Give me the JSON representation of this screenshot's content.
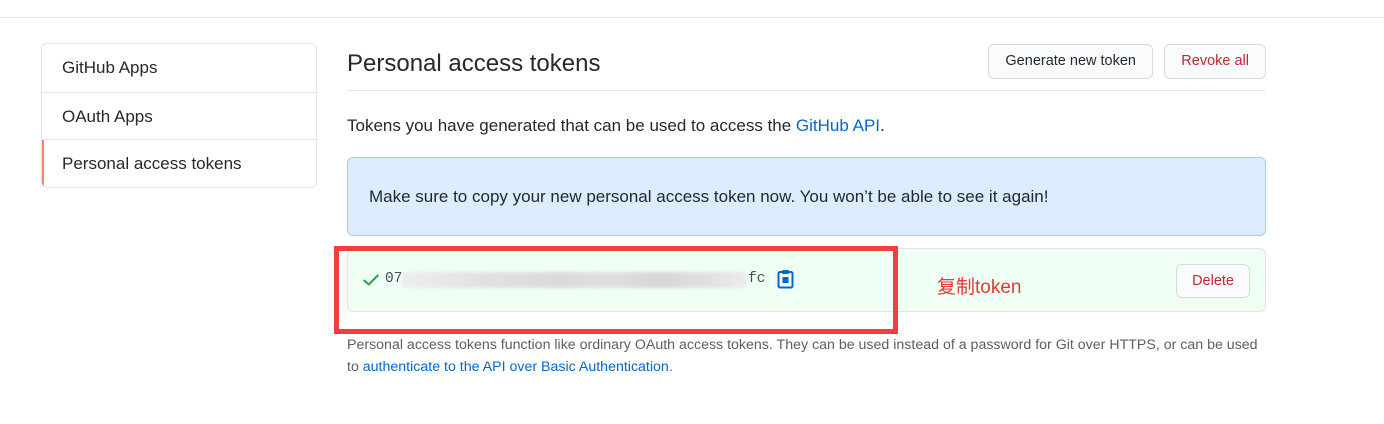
{
  "sidebar": {
    "items": [
      {
        "label": "GitHub Apps"
      },
      {
        "label": "OAuth Apps"
      },
      {
        "label": "Personal access tokens"
      }
    ]
  },
  "header": {
    "title": "Personal access tokens",
    "generate_label": "Generate new token",
    "revoke_label": "Revoke all"
  },
  "description": {
    "text": "Tokens you have generated that can be used to access the ",
    "link": "GitHub API",
    "end": "."
  },
  "flash": {
    "message": "Make sure to copy your new personal access token now. You won’t be able to see it again!"
  },
  "token": {
    "prefix": "07",
    "suffix": "fc",
    "delete_label": "Delete"
  },
  "annotation": {
    "label": "复制token"
  },
  "note": {
    "text": "Personal access tokens function like ordinary OAuth access tokens. They can be used instead of a password for Git over HTTPS, or can be used to ",
    "link": "authenticate to the API over Basic Authentication",
    "end": "."
  },
  "colors": {
    "accent_link": "#0366d6",
    "danger": "#cb2431",
    "flash_bg": "#dbedff",
    "success_bg": "#f0fff4",
    "annotation_red": "#ef3f3f"
  }
}
